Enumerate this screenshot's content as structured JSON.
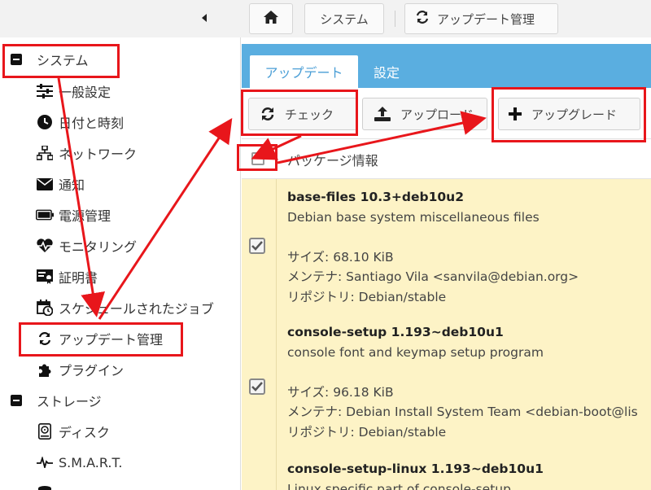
{
  "breadcrumb": {
    "home_icon": "home-icon",
    "items": [
      {
        "label": "システム"
      },
      {
        "label": "アップデート管理",
        "icon": "refresh-icon"
      }
    ]
  },
  "sidebar": {
    "sections": [
      {
        "label": "システム",
        "items": [
          {
            "label": "一般設定",
            "icon": "sliders-icon"
          },
          {
            "label": "日付と時刻",
            "icon": "clock-icon"
          },
          {
            "label": "ネットワーク",
            "icon": "sitemap-icon"
          },
          {
            "label": "通知",
            "icon": "envelope-icon"
          },
          {
            "label": "電源管理",
            "icon": "battery-icon"
          },
          {
            "label": "モニタリング",
            "icon": "heartbeat-icon"
          },
          {
            "label": "証明書",
            "icon": "certificate-icon"
          },
          {
            "label": "スケジュールされたジョブ",
            "icon": "calendar-clock-icon"
          },
          {
            "label": "アップデート管理",
            "icon": "refresh-icon"
          },
          {
            "label": "プラグイン",
            "icon": "puzzle-icon"
          }
        ]
      },
      {
        "label": "ストレージ",
        "items": [
          {
            "label": "ディスク",
            "icon": "hdd-icon"
          },
          {
            "label": "S.M.A.R.T.",
            "icon": "pulse-icon"
          }
        ]
      }
    ]
  },
  "tabs": [
    {
      "label": "アップデート",
      "active": true
    },
    {
      "label": "設定",
      "active": false
    }
  ],
  "toolbar": {
    "check_label": "チェック",
    "upload_label": "アップロード",
    "upgrade_label": "アップグレード"
  },
  "list": {
    "header_label": "パッケージ情報",
    "size_label": "サイズ",
    "maintainer_label": "メンテナ",
    "repo_label": "リポジトリ",
    "packages": [
      {
        "name": "base-files 10.3+deb10u2",
        "description": "Debian base system miscellaneous files",
        "size": "68.10 KiB",
        "maintainer": "Santiago Vila <sanvila@debian.org>",
        "repository": "Debian/stable",
        "checked": true
      },
      {
        "name": "console-setup 1.193~deb10u1",
        "description": "console font and keymap setup program",
        "size": "96.18 KiB",
        "maintainer": "Debian Install System Team <debian-boot@lis",
        "repository": "Debian/stable",
        "checked": true
      },
      {
        "name": "console-setup-linux 1.193~deb10u1",
        "description": "Linux specific part of console-setup"
      }
    ]
  },
  "colors": {
    "accent": "#5aaee0",
    "row_highlight": "#fdf3c6",
    "annotation_red": "#e8161b"
  }
}
